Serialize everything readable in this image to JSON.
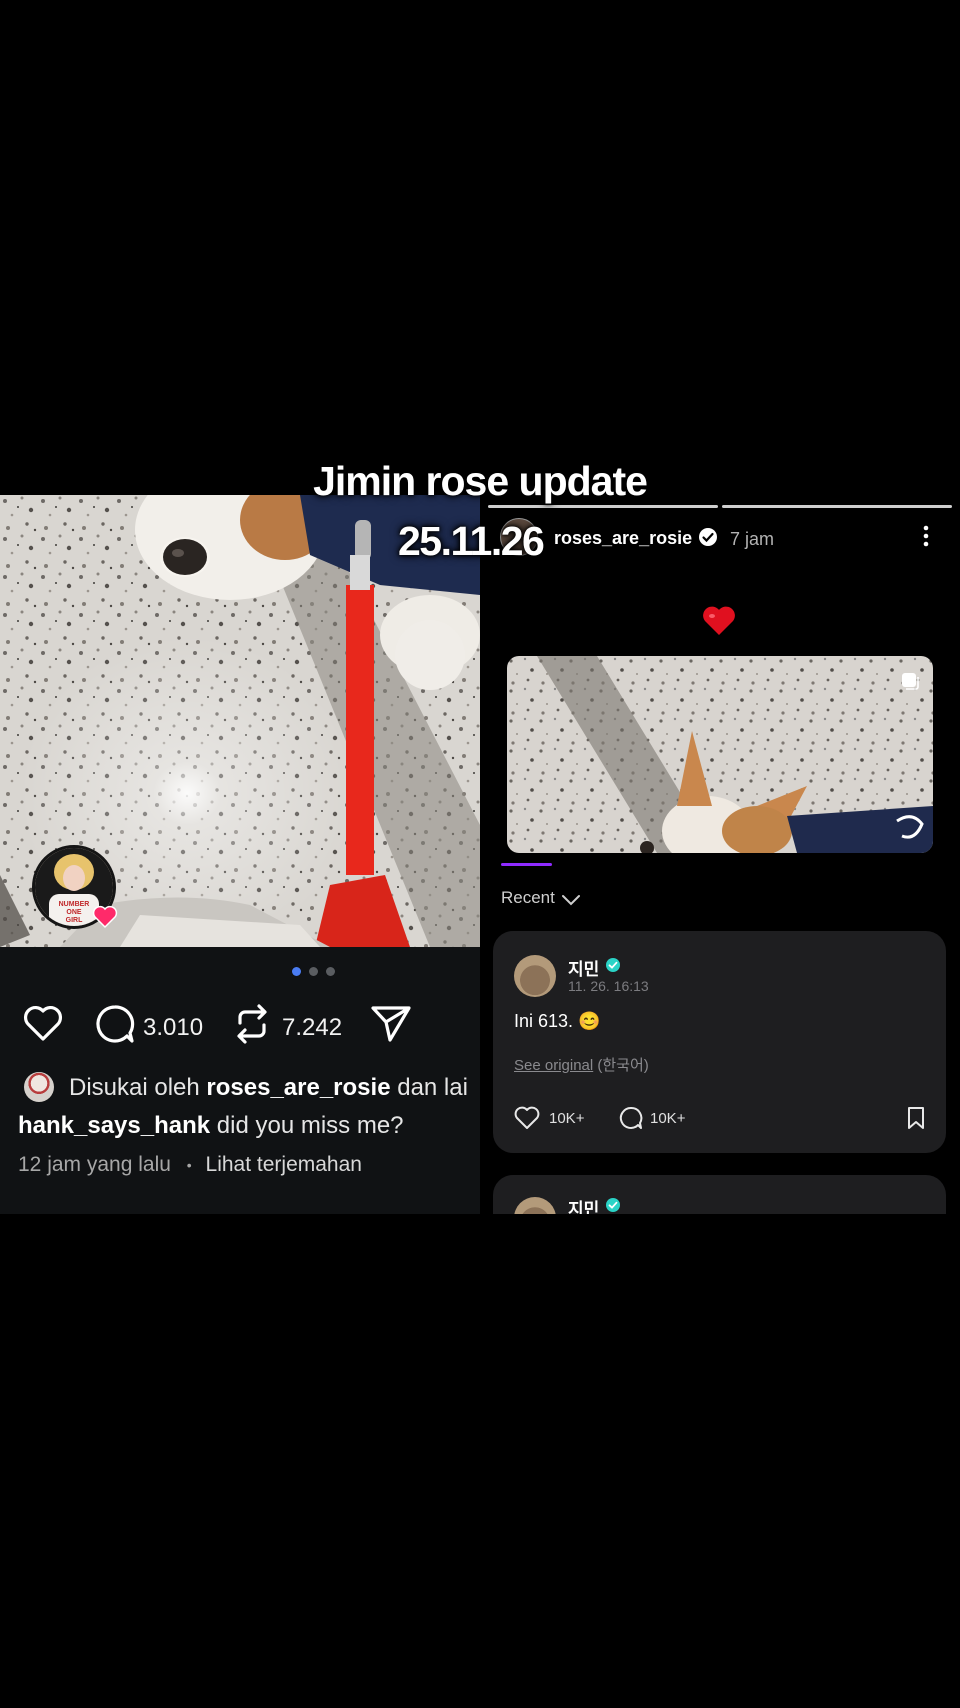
{
  "overlay": {
    "title": "Jimin rose update",
    "date": "25.11.26"
  },
  "left_post": {
    "pager_dots": 3,
    "active_dot": 1,
    "actions": {
      "comments": "3.010",
      "reposts": "7.242"
    },
    "liked_prefix": "Disukai oleh ",
    "liked_user": "roses_are_rosie",
    "liked_suffix": " dan lai",
    "caption_user": "hank_says_hank",
    "caption_text": " did you miss me?",
    "time_ago": "12 jam yang lalu",
    "separator": "•",
    "translate_link": "Lihat terjemahan",
    "story_avatar_text": "NUMBER ONE GIRL"
  },
  "right_story": {
    "username": "roses_are_rosie",
    "time": "7 jam",
    "heart_emoji": "❤️",
    "sort_label": "Recent",
    "comments": [
      {
        "name": "지민",
        "time": "11. 26. 16:13",
        "text": "Ini 613. 😊",
        "see_original": "See original",
        "language": " (한국어)",
        "likes": "10K+",
        "replies": "10K+"
      },
      {
        "name": "지민"
      }
    ]
  },
  "colors": {
    "accent_blue": "#4a7cf3",
    "purple": "#8f2bff",
    "verified_teal": "#2bd3c6",
    "leash_red": "#e8281c"
  }
}
